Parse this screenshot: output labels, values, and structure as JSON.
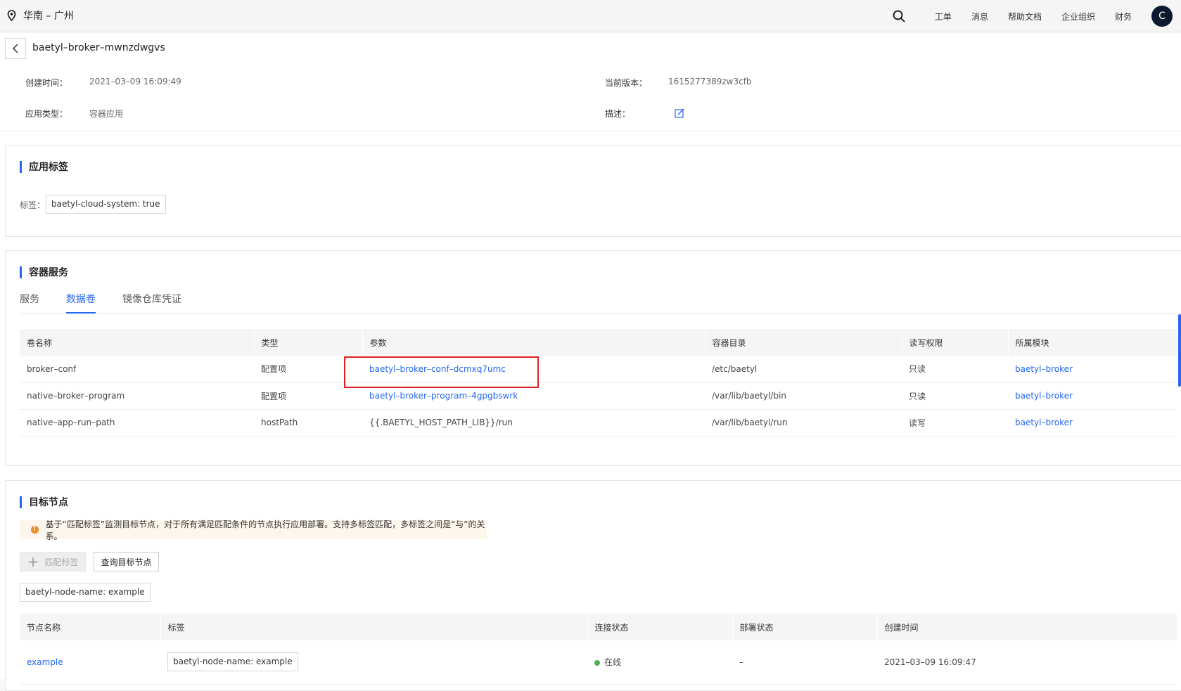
{
  "topbar": {
    "region": "华南 – 广州",
    "nav": [
      "工单",
      "消息",
      "帮助文档",
      "企业组织",
      "财务"
    ],
    "avatar_letter": "C"
  },
  "header": {
    "title": "baetyl–broker–mwnzdwgvs",
    "created_label": "创建时间：",
    "created_value": "2021–03–09 16:09:49",
    "version_label": "当前版本：",
    "version_value": "1615277389zw3cfb",
    "type_label": "应用类型：",
    "type_value": "容器应用",
    "desc_label": "描述："
  },
  "app_labels": {
    "title": "应用标签",
    "label_prefix": "标签：",
    "tag": "baetyl-cloud-system: true"
  },
  "container": {
    "title": "容器服务",
    "tabs": [
      "服务",
      "数据卷",
      "镜像仓库凭证"
    ],
    "active_tab": 1,
    "columns": [
      "卷名称",
      "类型",
      "参数",
      "容器目录",
      "读写权限",
      "所属模块"
    ],
    "rows": [
      {
        "name": "broker–conf",
        "type": "配置项",
        "param": "baetyl–broker–conf–dcmxq7umc",
        "dir": "/etc/baetyl",
        "perm": "只读",
        "module": "baetyl–broker"
      },
      {
        "name": "native–broker–program",
        "type": "配置项",
        "param": "baetyl–broker–program–4gpgbswrk",
        "dir": "/var/lib/baetyl/bin",
        "perm": "只读",
        "module": "baetyl–broker"
      },
      {
        "name": "native–app–run–path",
        "type": "hostPath",
        "param": "{{.BAETYL_HOST_PATH_LIB}}/run",
        "dir": "/var/lib/baetyl/run",
        "perm": "读写",
        "module": "baetyl–broker"
      }
    ]
  },
  "target": {
    "title": "目标节点",
    "notice": "基于“匹配标签”监测目标节点，对于所有满足匹配条件的节点执行应用部署。支持多标签匹配，多标签之间是“与”的关系。",
    "add_label": "匹配标签",
    "query_label": "查询目标节点",
    "tag": "baetyl-node-name: example",
    "columns": [
      "节点名称",
      "标签",
      "连接状态",
      "部署状态",
      "创建时间"
    ],
    "rows": [
      {
        "name": "example",
        "tag": "baetyl-node-name: example",
        "conn": "在线",
        "deploy": "–",
        "created": "2021–03–09 16:09:47"
      }
    ]
  }
}
